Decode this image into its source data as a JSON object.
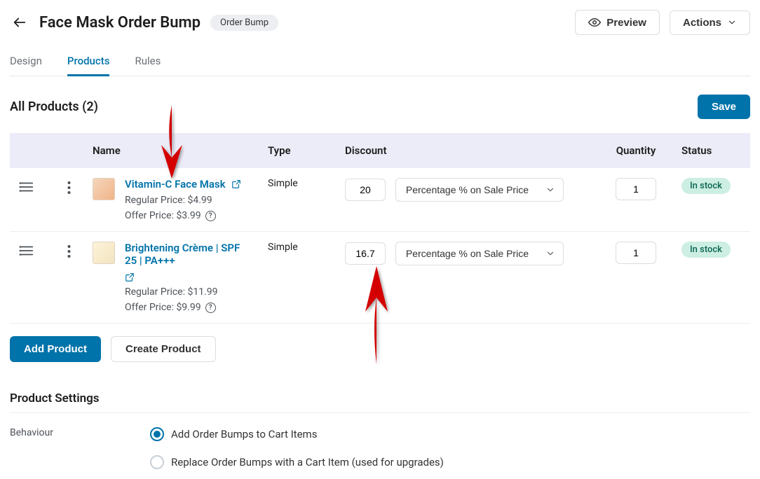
{
  "header": {
    "title": "Face Mask Order Bump",
    "type_pill": "Order Bump",
    "preview_label": "Preview",
    "actions_label": "Actions"
  },
  "tabs": {
    "design": "Design",
    "products": "Products",
    "rules": "Rules"
  },
  "products_section": {
    "heading": "All Products (2)",
    "save_label": "Save",
    "columns": {
      "name": "Name",
      "type": "Type",
      "discount": "Discount",
      "quantity": "Quantity",
      "status": "Status"
    },
    "discount_type_option": "Percentage % on Sale Price",
    "rows": [
      {
        "name": "Vitamin-C Face Mask",
        "regular_price": "Regular Price: $4.99",
        "offer_price": "Offer Price: $3.99",
        "type": "Simple",
        "discount": "20",
        "quantity": "1",
        "status": "In stock"
      },
      {
        "name": "Brightening Crème | SPF 25 | PA+++",
        "regular_price": "Regular Price: $11.99",
        "offer_price": "Offer Price: $9.99",
        "type": "Simple",
        "discount": "16.7",
        "quantity": "1",
        "status": "In stock"
      }
    ],
    "add_product_label": "Add Product",
    "create_product_label": "Create Product"
  },
  "settings": {
    "heading": "Product Settings",
    "behaviour_label": "Behaviour",
    "options": {
      "add_to_cart": "Add Order Bumps to Cart Items",
      "replace": "Replace Order Bumps with a Cart Item (used for upgrades)"
    }
  }
}
